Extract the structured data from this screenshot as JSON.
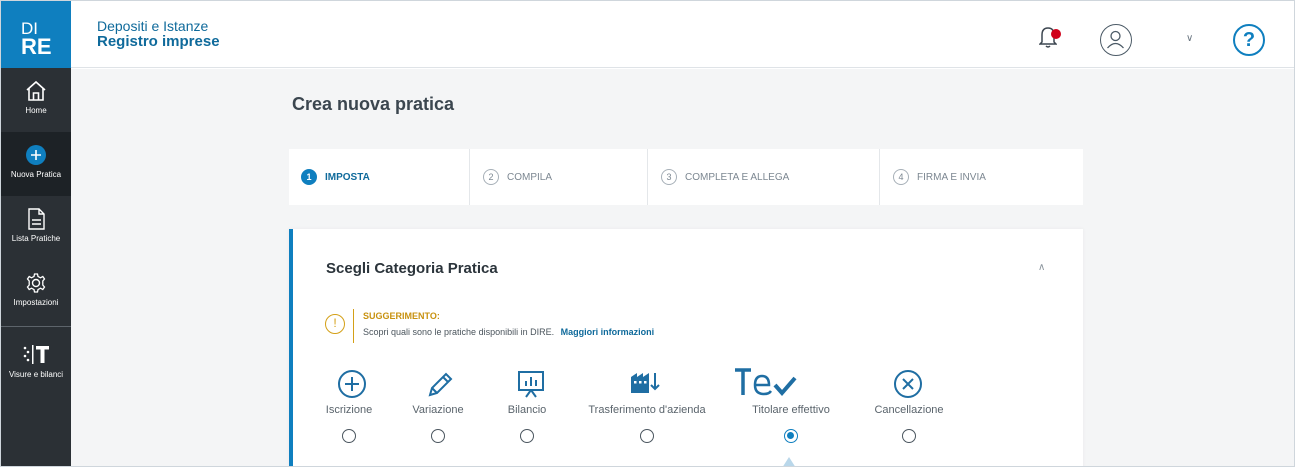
{
  "logo": {
    "line1": "DI",
    "line2": "RE"
  },
  "app": {
    "title": "Depositi e Istanze",
    "subtitle": "Registro imprese"
  },
  "header": {
    "help_label": "?"
  },
  "sidebar": {
    "items": [
      {
        "label": "Home",
        "icon": "home-icon"
      },
      {
        "label": "Nuova Pratica",
        "icon": "plus-icon",
        "active": true
      },
      {
        "label": "Lista Pratiche",
        "icon": "document-icon"
      },
      {
        "label": "Impostazioni",
        "icon": "gear-icon"
      },
      {
        "label": "Visure e bilanci",
        "icon": "t-logo-icon"
      }
    ]
  },
  "page": {
    "title": "Crea nuova pratica"
  },
  "steps": [
    {
      "num": "1",
      "label": "IMPOSTA",
      "active": true
    },
    {
      "num": "2",
      "label": "COMPILA"
    },
    {
      "num": "3",
      "label": "COMPLETA E ALLEGA"
    },
    {
      "num": "4",
      "label": "FIRMA E INVIA"
    }
  ],
  "card": {
    "title": "Scegli Categoria Pratica",
    "hint_title": "SUGGERIMENTO:",
    "hint_text": "Scopri quali sono le pratiche disponibili in DIRE.",
    "hint_link": "Maggiori informazioni"
  },
  "categories": [
    {
      "label": "Iscrizione",
      "icon": "plus-circle-icon",
      "selected": false
    },
    {
      "label": "Variazione",
      "icon": "pencil-icon",
      "selected": false
    },
    {
      "label": "Bilancio",
      "icon": "chart-board-icon",
      "selected": false
    },
    {
      "label": "Trasferimento d'azienda",
      "icon": "factory-icon",
      "selected": false
    },
    {
      "label": "Titolare effettivo",
      "icon": "te-check-icon",
      "selected": true
    },
    {
      "label": "Cancellazione",
      "icon": "x-circle-icon",
      "selected": false
    }
  ],
  "colors": {
    "brand": "#0f7fbf",
    "sidebar": "#2b3035",
    "hint": "#d4a017",
    "notification": "#d0021b"
  }
}
